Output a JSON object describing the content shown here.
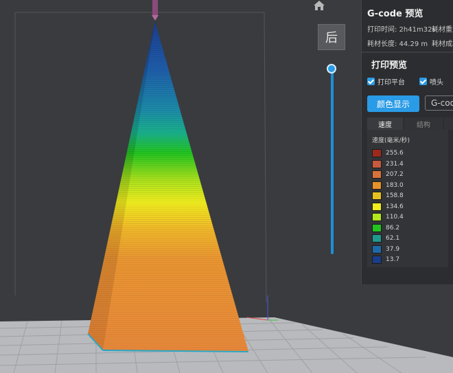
{
  "viewport": {
    "view_button_label": "后",
    "slider_level_percent": 100
  },
  "panel": {
    "gcode_preview_title": "G-code 预览",
    "print_time": "打印时间: 2h41m32s",
    "filament_weight": "耗材重量",
    "filament_length": "耗材长度: 44.29 m",
    "filament_cost": "耗材成本",
    "print_preview_title": "打印预览",
    "checkbox_platform": "打印平台",
    "checkbox_nozzle": "喷头",
    "color_display_button": "颜色显示",
    "gcode_button": "G-code",
    "tabs": [
      {
        "label": "速度",
        "active": true
      },
      {
        "label": "结构",
        "active": false
      },
      {
        "label": "",
        "active": false
      }
    ],
    "legend_title": "速度(毫米/秒)",
    "legend": [
      {
        "value": "255.6",
        "color": "#9c2a1c"
      },
      {
        "value": "231.4",
        "color": "#c75a3f"
      },
      {
        "value": "207.2",
        "color": "#d8723a"
      },
      {
        "value": "183.0",
        "color": "#e6922a"
      },
      {
        "value": "158.8",
        "color": "#e5c21f"
      },
      {
        "value": "134.6",
        "color": "#f0ec1e"
      },
      {
        "value": "110.4",
        "color": "#b3e61c"
      },
      {
        "value": "86.2",
        "color": "#22c31f"
      },
      {
        "value": "62.1",
        "color": "#1f9a8f"
      },
      {
        "value": "37.9",
        "color": "#1e6aa9"
      },
      {
        "value": "13.7",
        "color": "#1a3d8a"
      }
    ]
  },
  "colors": {
    "accent": "#2a9be6",
    "background": "#3a3b3e",
    "panel": "#2c2d30"
  }
}
